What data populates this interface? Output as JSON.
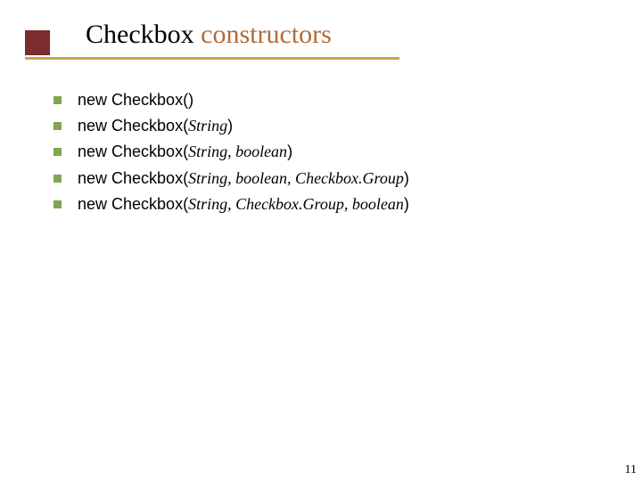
{
  "title": {
    "part1": "Checkbox",
    "part2": " constructors"
  },
  "bullets": [
    {
      "prefix": "new Checkbox(",
      "args": "",
      "suffix": ")"
    },
    {
      "prefix": "new Checkbox(",
      "args": "String",
      "suffix": ")"
    },
    {
      "prefix": "new Checkbox(",
      "args": "String, boolean",
      "suffix": ")"
    },
    {
      "prefix": "new Checkbox(",
      "args": "String, boolean, Checkbox.Group",
      "suffix": ")"
    },
    {
      "prefix": "new Checkbox(",
      "args": "String, Checkbox.Group, boolean",
      "suffix": ")"
    }
  ],
  "page_number": "11"
}
